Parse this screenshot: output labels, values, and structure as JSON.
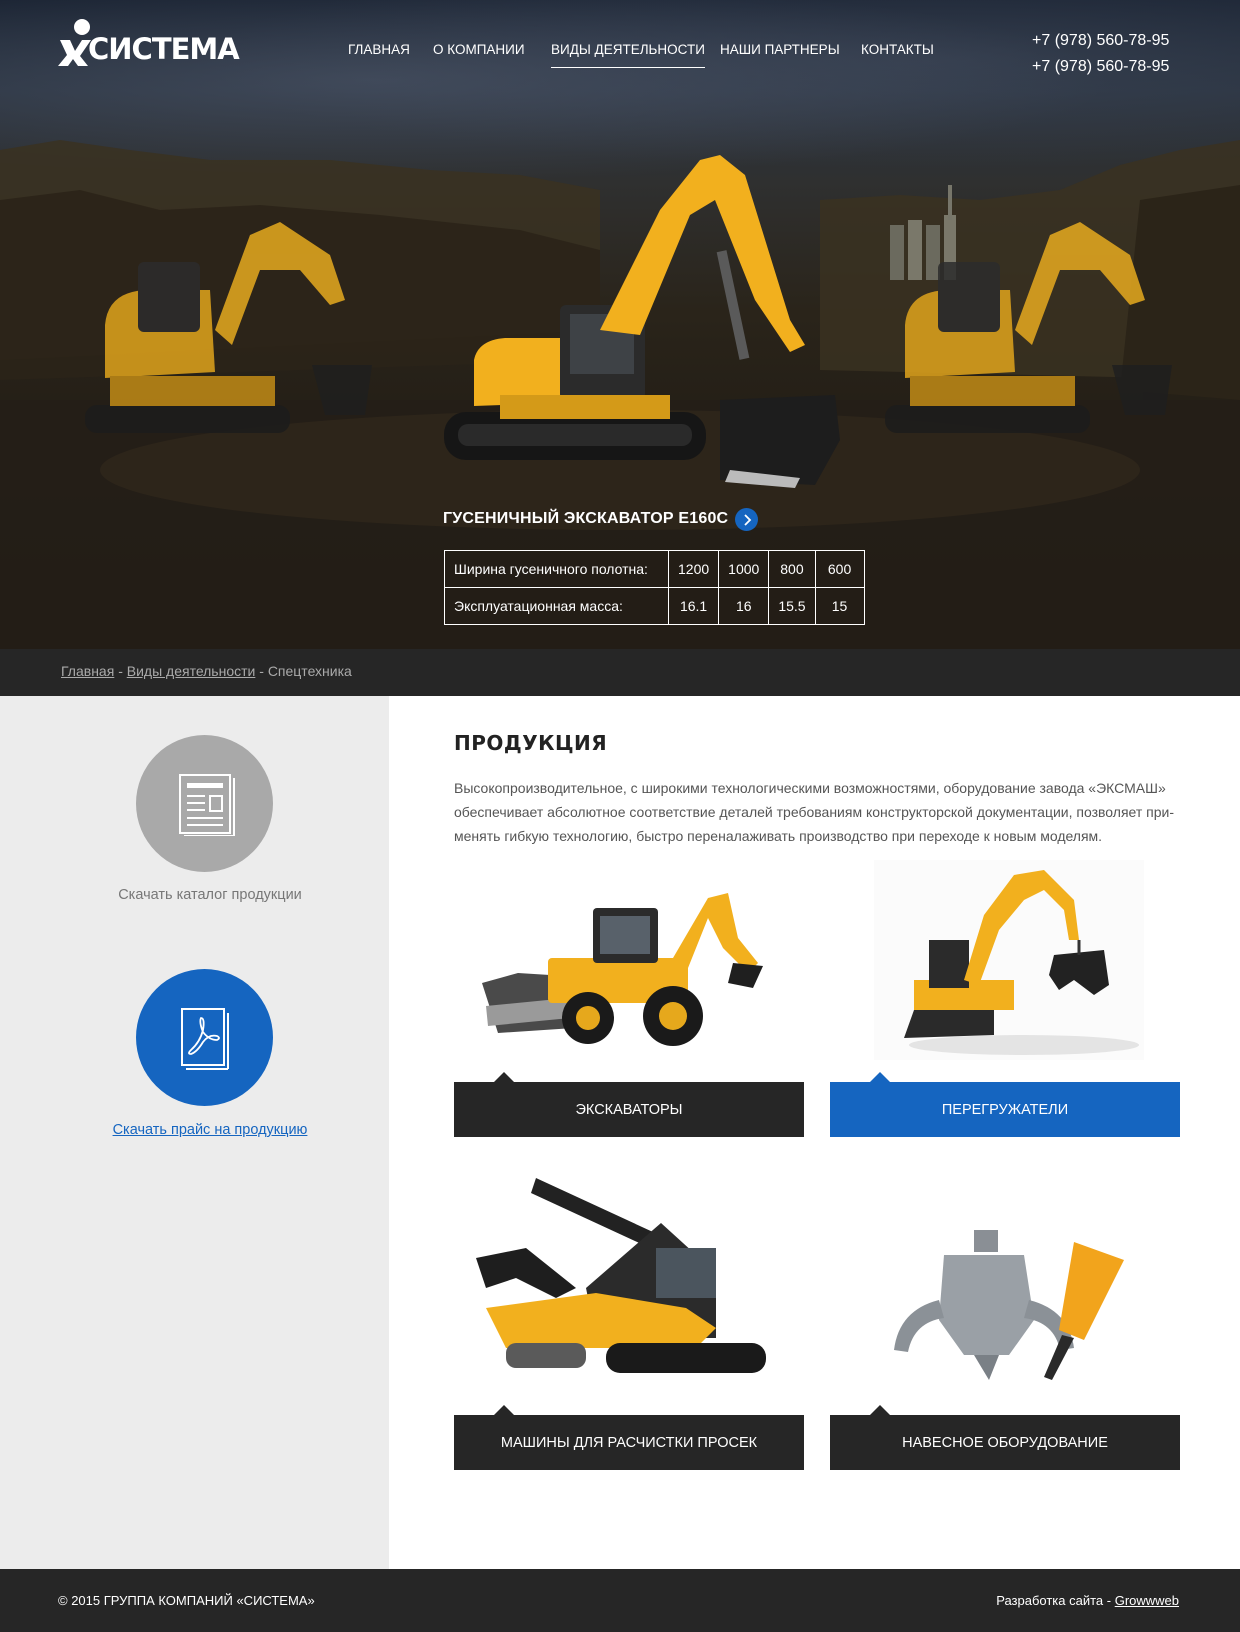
{
  "header": {
    "logo_text": "СИСТЕМА",
    "nav": [
      {
        "label": "ГЛАВНАЯ"
      },
      {
        "label": "О КОМПАНИИ"
      },
      {
        "label": "ВИДЫ ДЕЯТЕЛЬНОСТИ",
        "active": true
      },
      {
        "label": "НАШИ ПАРТНЕРЫ"
      },
      {
        "label": "КОНТАКТЫ"
      }
    ],
    "phones": [
      "+7 (978) 560-78-95",
      "+7 (978) 560-78-95"
    ]
  },
  "hero": {
    "title": "ГУСЕНИЧНЫЙ ЭКСКАВАТОР E160C",
    "arrow_icon": "chevron-right-icon",
    "spec_rows": [
      {
        "label": "Ширина гусеничного полотна:",
        "values": [
          "1200",
          "1000",
          "800",
          "600"
        ]
      },
      {
        "label": "Эксплуатационная масса:",
        "values": [
          "16.1",
          "16",
          "15.5",
          "15"
        ]
      }
    ]
  },
  "breadcrumb": {
    "items": [
      "Главная",
      "Виды деятельности"
    ],
    "separator": "-",
    "current": "Спецтехника"
  },
  "sidebar": {
    "catalog_label": "Скачать каталог продукции",
    "catalog_icon": "document-icon",
    "price_label": "Скачать прайс на продукцию",
    "price_icon": "pdf-icon"
  },
  "main": {
    "title": "ПРОДУКЦИЯ",
    "description": "Высокопроизводительное, с широкими технологическими возможностями, оборудование завода «ЭКСМАШ» обеспечивает абсолютное соответствие деталей требованиям конструкторской документации, позволяет при-менять гибкую технологию, быстро переналаживать производство при переходе к новым моделям.",
    "cards": [
      {
        "label": "ЭКСКАВАТОРЫ",
        "image": "backhoe-loader",
        "highlight": false
      },
      {
        "label": "ПЕРЕГРУЖАТЕЛИ",
        "image": "material-handler",
        "highlight": true
      },
      {
        "label": "МАШИНЫ ДЛЯ РАСЧИСТКИ ПРОСЕК",
        "image": "forestry-mulcher",
        "highlight": false
      },
      {
        "label": "НАВЕСНОЕ ОБОРУДОВАНИЕ",
        "image": "grapple-and-hammer",
        "highlight": false
      }
    ]
  },
  "footer": {
    "copyright": "© 2015 ГРУППА КОМПАНИЙ «СИСТЕМА»",
    "dev_prefix": "Разработка сайта - ",
    "dev_link": "Growwweb"
  },
  "colors": {
    "accent": "#1565c0",
    "dark": "#262626",
    "sidebar_bg": "#ececec",
    "machine_yellow": "#f2b01e"
  }
}
